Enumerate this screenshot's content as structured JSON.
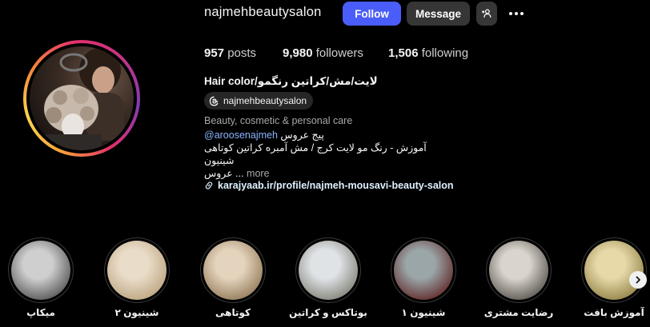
{
  "profile": {
    "username": "najmehbeautysalon",
    "full_name": "لایت/مش/کراتین رنگمو/Hair color",
    "threads_handle": "najmehbeautysalon"
  },
  "actions": {
    "follow_label": "Follow",
    "message_label": "Message",
    "add_user_icon": "add-user-icon",
    "more_icon": "more-icon"
  },
  "stats": {
    "posts": {
      "value": "957",
      "label": "posts"
    },
    "followers": {
      "value": "9,980",
      "label": "followers"
    },
    "following": {
      "value": "1,506",
      "label": "following"
    }
  },
  "bio": {
    "category": "Beauty, cosmetic & personal care",
    "mention": "@aroosenajmeh",
    "mention_suffix": "پیج عروس",
    "line2": "آموزش - رنگ مو لایت کرج / مش آمبره کراتین کوتاهی",
    "line3": "شینیون",
    "line4_text": "عروس ...",
    "line4_more": "more",
    "link": "karajyaab.ir/profile/najmeh-mousavi-beauty-salon"
  },
  "highlights": [
    {
      "label": "میکاپ",
      "colors": [
        "#cfcfcf",
        "#4a4a4a"
      ]
    },
    {
      "label": "شینیون ۲",
      "colors": [
        "#e9dcc8",
        "#b8a07a"
      ]
    },
    {
      "label": "کوتاهی",
      "colors": [
        "#e4d3bd",
        "#8c7350"
      ]
    },
    {
      "label": "بوتاکس و کراتین",
      "colors": [
        "#dfe3e6",
        "#7a7a6e"
      ]
    },
    {
      "label": "شینیون ۱",
      "colors": [
        "#9aa6a8",
        "#5c1f1f"
      ]
    },
    {
      "label": "رضایت مشتری",
      "colors": [
        "#d9d4cc",
        "#4d4a44"
      ]
    },
    {
      "label": "آموزش بافت",
      "colors": [
        "#e7d9a8",
        "#8a7a3e"
      ]
    }
  ],
  "colors": {
    "accent": "#4a5df9",
    "secondary_button": "#363636",
    "background": "#000000"
  }
}
